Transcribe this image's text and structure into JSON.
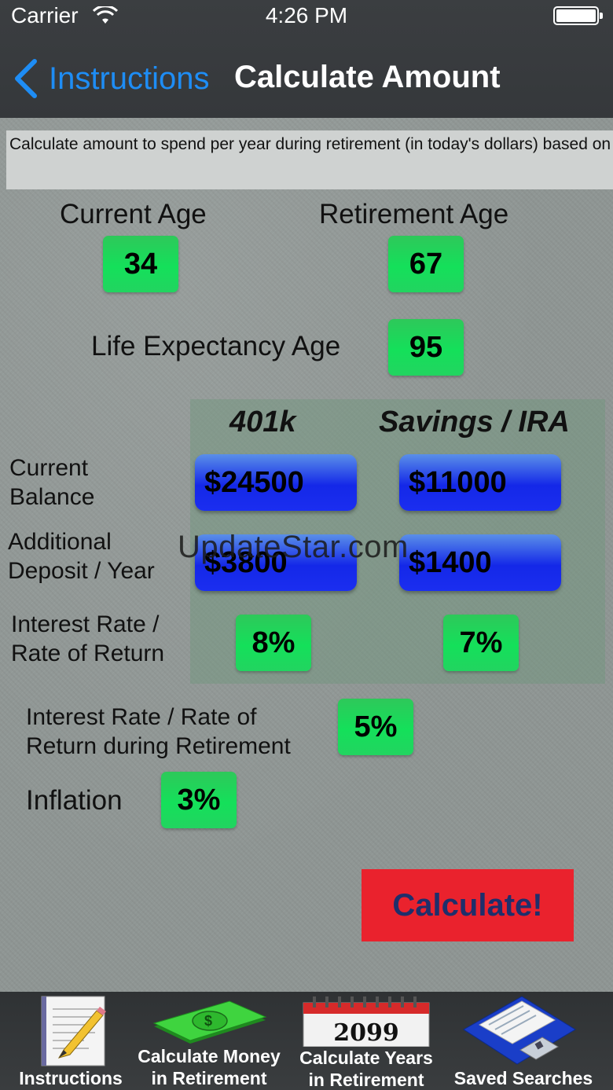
{
  "status_bar": {
    "carrier": "Carrier",
    "time": "4:26 PM"
  },
  "nav": {
    "back_label": "Instructions",
    "title": "Calculate Amount"
  },
  "description": "Calculate amount to spend per year during retirement (in today's dollars) based on planned number of years in retirement",
  "ages": {
    "current_age_label": "Current Age",
    "current_age_value": "34",
    "retirement_age_label": "Retirement Age",
    "retirement_age_value": "67",
    "life_expectancy_label": "Life Expectancy Age",
    "life_expectancy_value": "95"
  },
  "accounts": {
    "col_401k": "401k",
    "col_savings": "Savings / IRA",
    "current_balance_label_1": "Current",
    "current_balance_label_2": "Balance",
    "balance_401k": "$24500",
    "balance_savings": "$11000",
    "deposit_label_1": "Additional",
    "deposit_label_2": "Deposit / Year",
    "deposit_401k": "$3800",
    "deposit_savings": "$1400",
    "rate_label_1": "Interest Rate /",
    "rate_label_2": "Rate of Return",
    "rate_401k": "8%",
    "rate_savings": "7%"
  },
  "retirement": {
    "rate_label_1": "Interest Rate / Rate of",
    "rate_label_2": "Return during Retirement",
    "rate_value": "5%",
    "inflation_label": "Inflation",
    "inflation_value": "3%"
  },
  "calculate_label": "Calculate!",
  "watermark": "UpdateStar.com",
  "tabs": [
    {
      "label_1": "Instructions",
      "label_2": "",
      "icon": "notepad-pencil-icon"
    },
    {
      "label_1": "Calculate Money",
      "label_2": "in Retirement",
      "icon": "money-stack-icon"
    },
    {
      "label_1": "Calculate Years",
      "label_2": "in Retirement",
      "icon": "calendar-icon",
      "calendar_year": "2099"
    },
    {
      "label_1": "Saved Searches",
      "label_2": "",
      "icon": "floppy-disk-icon"
    }
  ],
  "colors": {
    "back_link": "#1e8df5",
    "value_green": "#14e05a",
    "value_blue": "#1428e8",
    "calculate_red": "#ea222d"
  }
}
